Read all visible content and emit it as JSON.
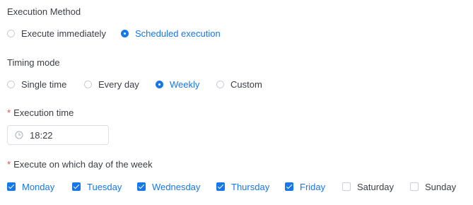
{
  "execution_method": {
    "label": "Execution Method",
    "options": [
      {
        "label": "Execute immediately",
        "checked": false
      },
      {
        "label": "Scheduled execution",
        "checked": true
      }
    ]
  },
  "timing_mode": {
    "label": "Timing mode",
    "options": [
      {
        "label": "Single time",
        "checked": false
      },
      {
        "label": "Every day",
        "checked": false
      },
      {
        "label": "Weekly",
        "checked": true
      },
      {
        "label": "Custom",
        "checked": false
      }
    ]
  },
  "execution_time": {
    "required_mark": "*",
    "label": "Execution time",
    "value": "18:22",
    "icon": "clock-icon"
  },
  "weekdays": {
    "required_mark": "*",
    "label": "Execute on which day of the week",
    "days": [
      {
        "label": "Monday",
        "checked": true
      },
      {
        "label": "Tuesday",
        "checked": true
      },
      {
        "label": "Wednesday",
        "checked": true
      },
      {
        "label": "Thursday",
        "checked": true
      },
      {
        "label": "Friday",
        "checked": true
      },
      {
        "label": "Saturday",
        "checked": false
      },
      {
        "label": "Sunday",
        "checked": false
      }
    ]
  },
  "colors": {
    "accent": "#1677e9",
    "required": "#f24d4d",
    "text": "#3b3f45",
    "border": "#c9cdd4"
  }
}
